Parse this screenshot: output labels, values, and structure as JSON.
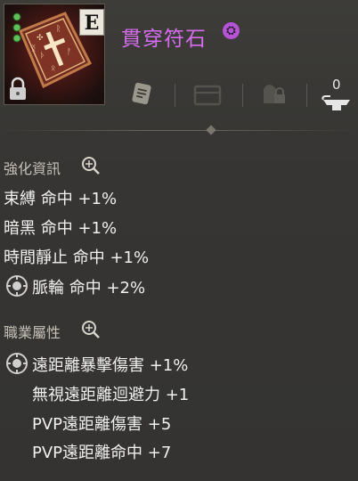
{
  "item": {
    "name": "貫穿符石",
    "grade": "E",
    "name_badge_glyph": "⛭",
    "icon": "spellbook-icon"
  },
  "action_bar": {
    "icons": [
      "note-icon",
      "drawer-icon",
      "lock-bag-icon",
      "anvil-icon"
    ],
    "anvil_count": "0"
  },
  "enhance_section": {
    "title": "強化資訊",
    "lines": [
      "束縛 命中 +1%",
      "暗黑 命中 +1%",
      "時間靜止 命中 +1%",
      "脈輪 命中 +2%"
    ]
  },
  "class_section": {
    "title": "職業屬性",
    "lines": [
      "遠距離暴擊傷害 +1%",
      "無視遠距離迴避力 +1",
      "PVP遠距離傷害 +5",
      "PVP遠距離命中 +7"
    ]
  },
  "colors": {
    "item_name": "#d56df0",
    "text": "#f0f0f0",
    "section_title": "#c3c0b6"
  }
}
